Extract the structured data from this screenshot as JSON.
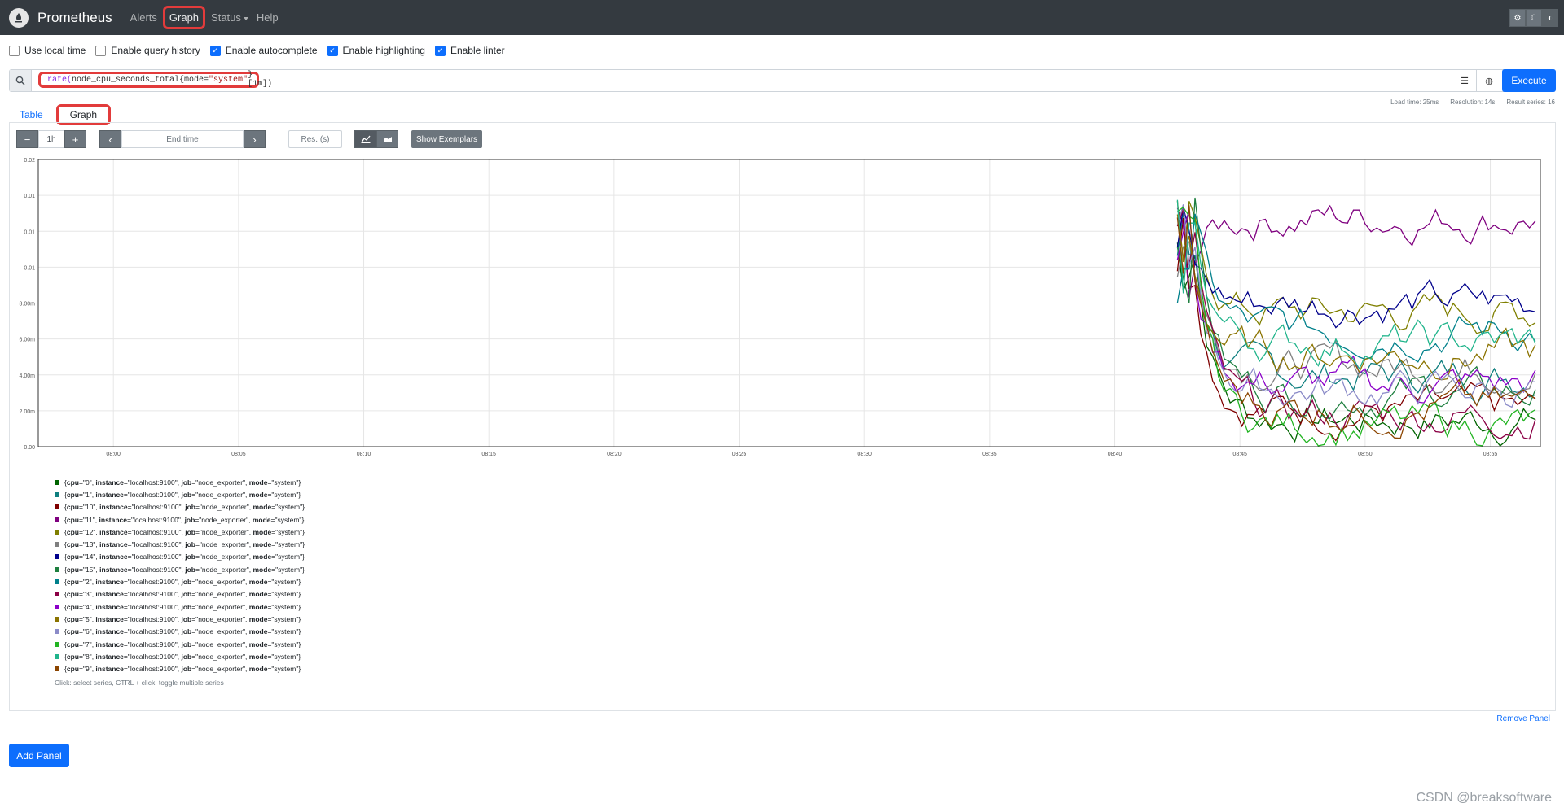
{
  "navbar": {
    "brand": "Prometheus",
    "links": [
      {
        "label": "Alerts"
      },
      {
        "label": "Graph"
      },
      {
        "label": "Status"
      },
      {
        "label": "Help"
      }
    ],
    "theme_icons": [
      "gear-icon",
      "moon-icon",
      "contrast-icon"
    ]
  },
  "options": [
    {
      "label": "Use local time",
      "checked": false
    },
    {
      "label": "Enable query history",
      "checked": false
    },
    {
      "label": "Enable autocomplete",
      "checked": true
    },
    {
      "label": "Enable highlighting",
      "checked": true
    },
    {
      "label": "Enable linter",
      "checked": true
    }
  ],
  "query": {
    "fn": "rate(",
    "metric": "node_cpu_seconds_total{mode=",
    "str": "\"system\"",
    "tail": "}[1m])",
    "execute_label": "Execute"
  },
  "stats": {
    "load_time": "Load time: 25ms",
    "resolution": "Resolution: 14s",
    "result_series": "Result series: 16"
  },
  "tabs": [
    {
      "label": "Table"
    },
    {
      "label": "Graph"
    }
  ],
  "controls": {
    "minus": "−",
    "range": "1h",
    "plus": "+",
    "prev": "‹",
    "end_time": "End time",
    "next": "›",
    "res": "Res. (s)",
    "show_exemplars": "Show Exemplars"
  },
  "chart_data": {
    "type": "line",
    "y_ticks": [
      "0.02",
      "0.01",
      "0.01",
      "0.01",
      "8.00m",
      "6.00m",
      "4.00m",
      "2.00m",
      "0.00"
    ],
    "x_ticks": [
      "08:00",
      "08:05",
      "08:10",
      "08:15",
      "08:20",
      "08:25",
      "08:30",
      "08:35",
      "08:40",
      "08:45",
      "08:50",
      "08:55"
    ],
    "ylim": [
      0,
      0.016
    ],
    "x_range_minutes": [
      -3,
      57
    ],
    "data_start_minute": 42.5,
    "series_colors": [
      "#006400",
      "#0f7f7f",
      "#7f0000",
      "#7f007f",
      "#7f7f00",
      "#7f7f7f",
      "#00008b",
      "#1e7f3f",
      "#00808b",
      "#8b0045",
      "#8b00c8",
      "#8b7300",
      "#8b8bc8",
      "#22b422",
      "#20b48b",
      "#8b4500"
    ],
    "series_levels": [
      0.0015,
      0.004,
      0.002,
      0.0128,
      0.0075,
      0.0045,
      0.008,
      0.003,
      0.0065,
      0.0018,
      0.0035,
      0.0052,
      0.0032,
      0.0012,
      0.0058,
      0.0022
    ]
  },
  "legend": {
    "items": [
      {
        "cpu": "0"
      },
      {
        "cpu": "1"
      },
      {
        "cpu": "10"
      },
      {
        "cpu": "11"
      },
      {
        "cpu": "12"
      },
      {
        "cpu": "13"
      },
      {
        "cpu": "14"
      },
      {
        "cpu": "15"
      },
      {
        "cpu": "2"
      },
      {
        "cpu": "3"
      },
      {
        "cpu": "4"
      },
      {
        "cpu": "5"
      },
      {
        "cpu": "6"
      },
      {
        "cpu": "7"
      },
      {
        "cpu": "8"
      },
      {
        "cpu": "9"
      }
    ],
    "instance": "localhost:9100",
    "job": "node_exporter",
    "mode": "system",
    "hint": "Click: select series, CTRL + click: toggle multiple series"
  },
  "remove_panel": "Remove Panel",
  "add_panel": "Add Panel",
  "watermark": "CSDN @breaksoftware"
}
